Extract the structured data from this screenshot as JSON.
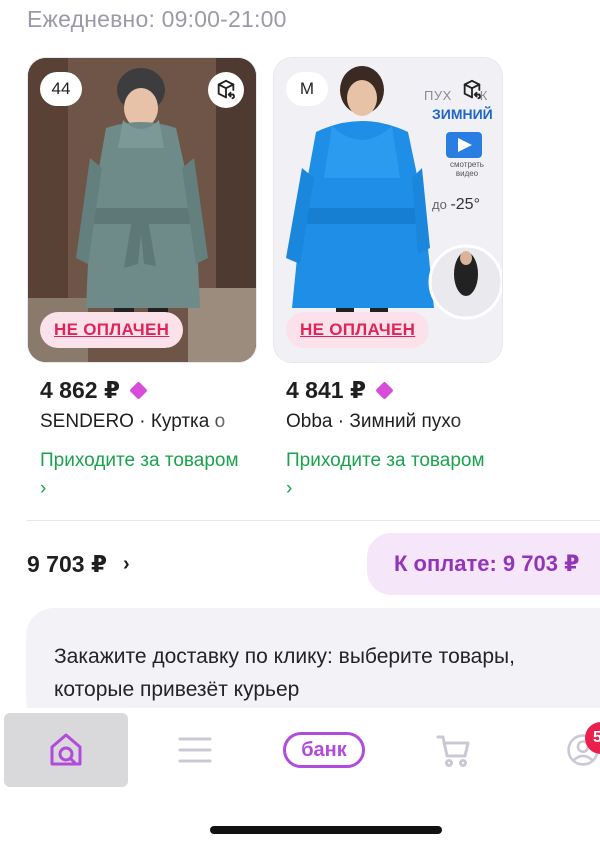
{
  "header": {
    "hours": "Ежедневно: 09:00-21:00"
  },
  "products": [
    {
      "size": "44",
      "status": "НЕ ОПЛАЧЕН",
      "price": "4 862 ₽",
      "title": "SENDERO · Куртка о",
      "pickup": "Приходите за товаром ›",
      "image": "photo of woman in grey-green belted puffer coat and grey knit hat"
    },
    {
      "size": "M",
      "status": "НЕ ОПЛАЧЕН",
      "price": "4 841 ₽",
      "title": "Obba · Зимний пухо",
      "pickup": "Приходите за товаром ›",
      "image": "photo of woman in bright blue belted puffer coat",
      "promo": {
        "line1": "ПУХ",
        "line1_end": "К",
        "line2": "ЗИМНИЙ",
        "video_label": "смотреть видео",
        "temp_prefix": "до",
        "temp": "-25°"
      }
    }
  ],
  "summary": {
    "total": "9 703 ₽",
    "chevron": "›",
    "pay_button": "К оплате: 9 703 ₽"
  },
  "info": {
    "text": "Закажите доставку по клику: выберите товары, которые привезёт курьер"
  },
  "tabbar": {
    "bank_label": "банк",
    "profile_badge": "5"
  },
  "colors": {
    "accent": "#b24bdc",
    "unpaid": "#e0245a",
    "pickup": "#1aa24d",
    "badge": "#ea1f4d"
  }
}
